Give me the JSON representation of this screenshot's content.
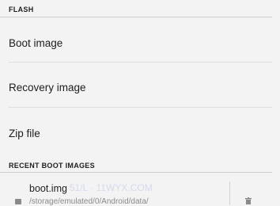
{
  "sections": {
    "flash_header": "FLASH",
    "recent_header": "RECENT BOOT IMAGES"
  },
  "flash_items": [
    {
      "label": "Boot image"
    },
    {
      "label": "Recovery image"
    },
    {
      "label": "Zip file"
    }
  ],
  "recent": [
    {
      "title": "boot.img",
      "path": "/storage/emulated/0/Android/data/",
      "icon": "file-icon",
      "action_icon": "delete-icon"
    }
  ],
  "watermark": "51/L   · 11WYX.COM"
}
